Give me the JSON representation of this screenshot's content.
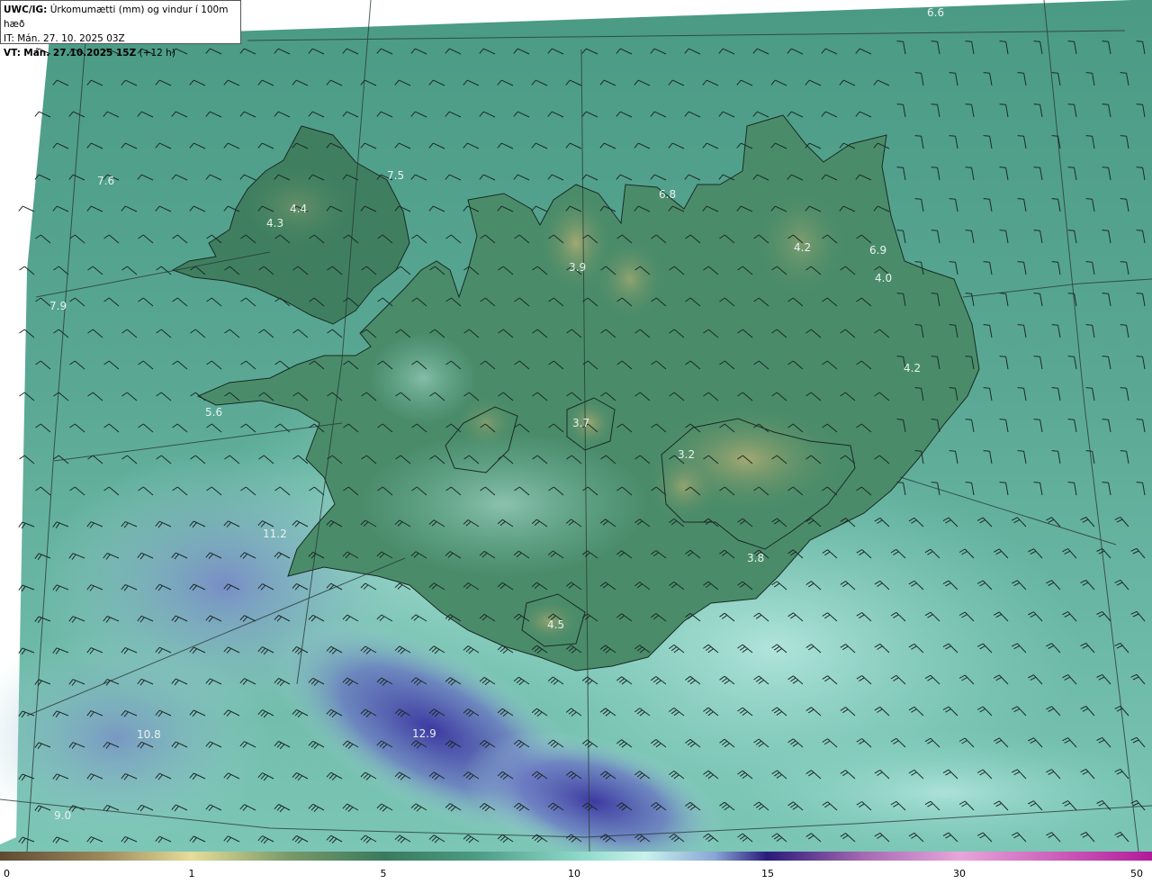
{
  "header": {
    "model": "UWC/IG:",
    "product": "Úrkomumætti (mm) og vindur í 100m hæð",
    "init_time": "IT: Mán. 27. 10. 2025 03Z",
    "valid_prefix": "VT:",
    "valid_time": "Mán. 27.10.2025 15Z",
    "lead": "(+12 h)"
  },
  "map_values": [
    {
      "label": "6.6"
    },
    {
      "label": "7.6"
    },
    {
      "label": "7.5"
    },
    {
      "label": "4.3"
    },
    {
      "label": "4.4"
    },
    {
      "label": "6.8"
    },
    {
      "label": "3.9"
    },
    {
      "label": "4.2"
    },
    {
      "label": "6.9"
    },
    {
      "label": "4.0"
    },
    {
      "label": "7.9"
    },
    {
      "label": "4.2"
    },
    {
      "label": "5.6"
    },
    {
      "label": "3.7"
    },
    {
      "label": "3.2"
    },
    {
      "label": "11.2"
    },
    {
      "label": "3.8"
    },
    {
      "label": "4.5"
    },
    {
      "label": "12.9"
    },
    {
      "label": "10.8"
    },
    {
      "label": "9.0"
    }
  ],
  "colorbar": {
    "ticks": [
      "0",
      "1",
      "5",
      "10",
      "15",
      "30",
      "50"
    ],
    "colors": [
      "#5e4a32",
      "#9c8a5e",
      "#e5dd9a",
      "#7a9a6a",
      "#3a7a5e",
      "#4a9a82",
      "#8ad6c6",
      "#c8f2ec",
      "#8aa6d6",
      "#4a4aa6",
      "#2a1a7a",
      "#a66ab2",
      "#e6a6da",
      "#b21a9a"
    ]
  },
  "colors": {
    "ocean": "#4e9e88",
    "land_dark": "#3f7f60",
    "precip_light": "#a6e6da",
    "precip_blue": "#6f7ac2",
    "precip_deep": "#4038a0",
    "highland": "#8a9e6a"
  }
}
